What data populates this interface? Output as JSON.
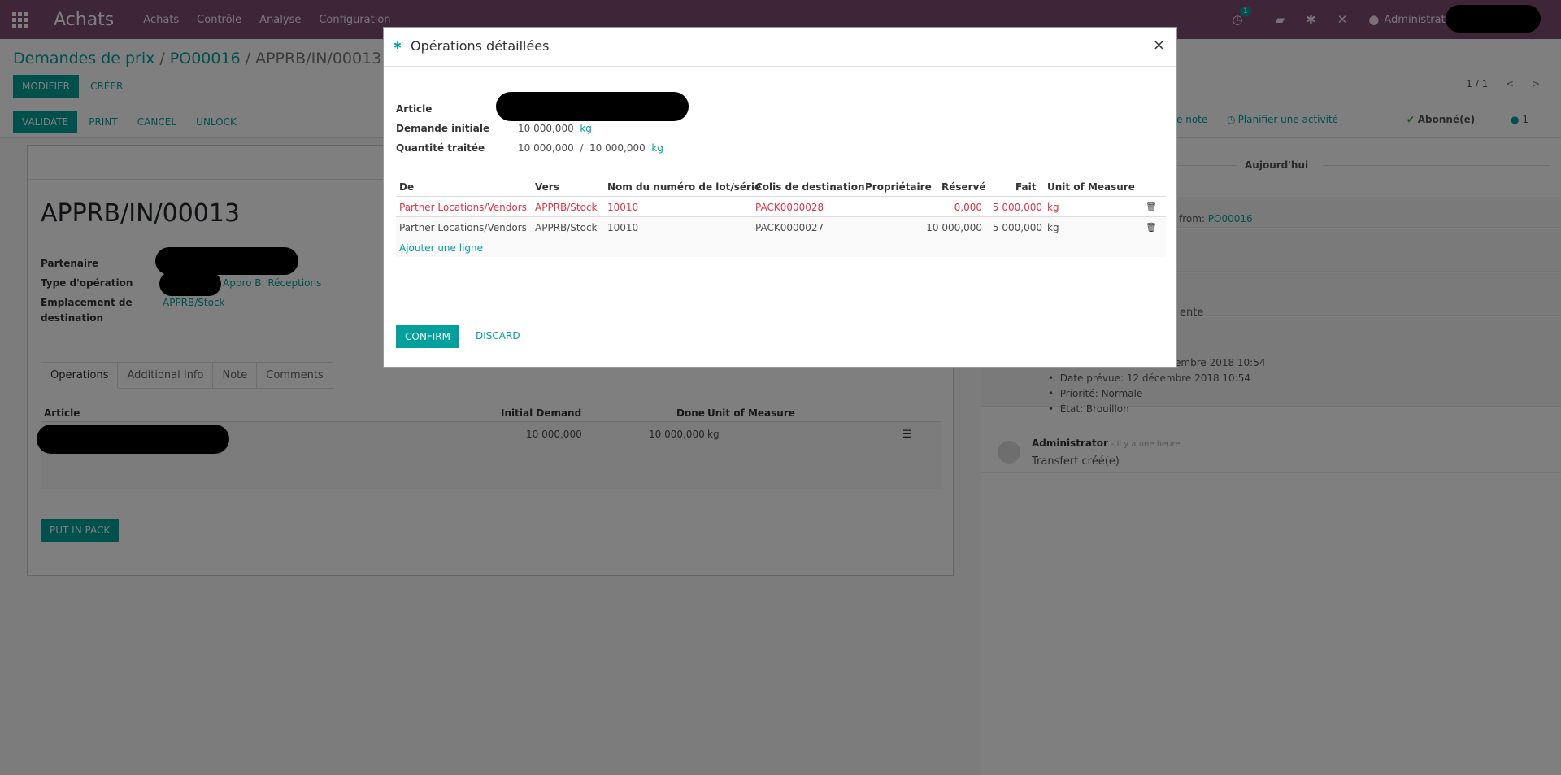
{
  "navbar": {
    "brand": "Achats",
    "menu": [
      "Achats",
      "Contrôle",
      "Analyse",
      "Configuration"
    ],
    "activity_count": "1",
    "user": "Administrator"
  },
  "control_panel": {
    "breadcrumb": [
      "Demandes de prix",
      "PO00016",
      "APPRB/IN/00013"
    ],
    "edit_label": "MODIFIER",
    "create_label": "CRÉER",
    "pager": "1 / 1",
    "status_buttons": [
      "VALIDATE",
      "PRINT",
      "CANCEL",
      "UNLOCK"
    ],
    "log_note": "ne note",
    "schedule_activity": "Planifier une activité",
    "followers": "Abonné(e)",
    "follower_count": "1"
  },
  "form": {
    "title": "APPRB/IN/00013",
    "partner_label": "Partenaire",
    "op_type_label": "Type d'opération",
    "op_type_value": "Appro B: Réceptions",
    "dest_label_1": "Emplacement de",
    "dest_label_2": "destination",
    "dest_value": "APPRB/Stock",
    "tabs": [
      "Operations",
      "Additional Info",
      "Note",
      "Comments"
    ],
    "ops_headers": [
      "Article",
      "Initial Demand",
      "Done",
      "Unit of Measure"
    ],
    "ops_row": {
      "initial": "10 000,000",
      "done": "10 000,000",
      "uom": "kg"
    },
    "put_in_pack": "PUT IN PACK"
  },
  "chatter": {
    "today": "Aujourd'hui",
    "from_prefix": "from:",
    "from_link": "PO00016",
    "pending_fragment": "ente",
    "date_fragment": "embre 2018 10:54",
    "bullets": [
      "Date prévue: 12 décembre 2018 10:54",
      "Priorité: Normale",
      "État: Brouillon"
    ],
    "author": "Administrator",
    "time": "- il y a une heure",
    "message": "Transfert créé(e)"
  },
  "modal": {
    "title": "Opérations détaillées",
    "close": "×",
    "article_label": "Article",
    "initial_label": "Demande initiale",
    "initial_value": "10 000,000",
    "initial_unit": "kg",
    "processed_label": "Quantité traitée",
    "processed_done": "10 000,000",
    "processed_sep": "/",
    "processed_total": "10 000,000",
    "processed_unit": "kg",
    "headers": [
      "De",
      "Vers",
      "Nom du numéro de lot/série",
      "Colis de destination",
      "Propriétaire",
      "Réservé",
      "Fait",
      "Unit of Measure"
    ],
    "rows": [
      {
        "from": "Partner Locations/Vendors",
        "to": "APPRB/Stock",
        "lot": "10010",
        "pack": "PACK0000028",
        "owner": "",
        "reserved": "0,000",
        "done": "5 000,000",
        "uom": "kg"
      },
      {
        "from": "Partner Locations/Vendors",
        "to": "APPRB/Stock",
        "lot": "10010",
        "pack": "PACK0000027",
        "owner": "",
        "reserved": "10 000,000",
        "done": "5 000,000",
        "uom": "kg"
      }
    ],
    "add_line": "Ajouter une ligne",
    "confirm": "CONFIRM",
    "discard": "DISCARD"
  },
  "colors": {
    "brand": "#7c4a6f",
    "accent": "#00a09d",
    "danger": "#dc3545"
  }
}
